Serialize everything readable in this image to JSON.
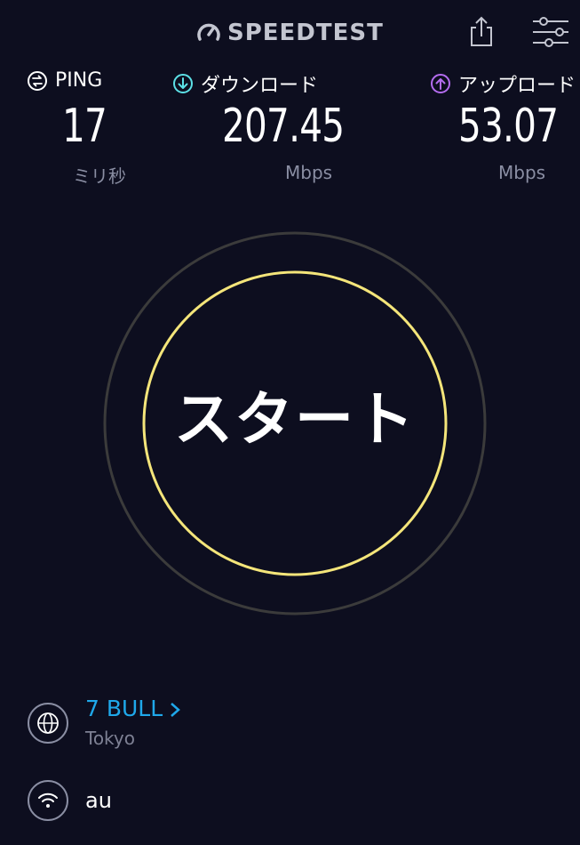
{
  "header": {
    "logo_text": "SPEEDTEST",
    "share_icon": "share-icon",
    "settings_icon": "settings-sliders-icon"
  },
  "metrics": {
    "ping": {
      "label": "PING",
      "value": "17",
      "unit": "ミリ秒",
      "icon": "ping-icon",
      "color": "#ffffff"
    },
    "download": {
      "label": "ダウンロード",
      "value": "207.45",
      "unit": "Mbps",
      "icon": "download-arrow-icon",
      "color": "#5ce0e6"
    },
    "upload": {
      "label": "アップロード",
      "value": "53.07",
      "unit": "Mbps",
      "icon": "upload-arrow-icon",
      "color": "#b46cf0"
    }
  },
  "start": {
    "label": "スタート",
    "ring_color": "#f4e57a",
    "outer_ring_color": "#3a3a3a"
  },
  "server": {
    "name": "7 BULL",
    "city": "Tokyo",
    "icon": "globe-icon"
  },
  "provider": {
    "name": "au",
    "icon": "wifi-icon"
  }
}
